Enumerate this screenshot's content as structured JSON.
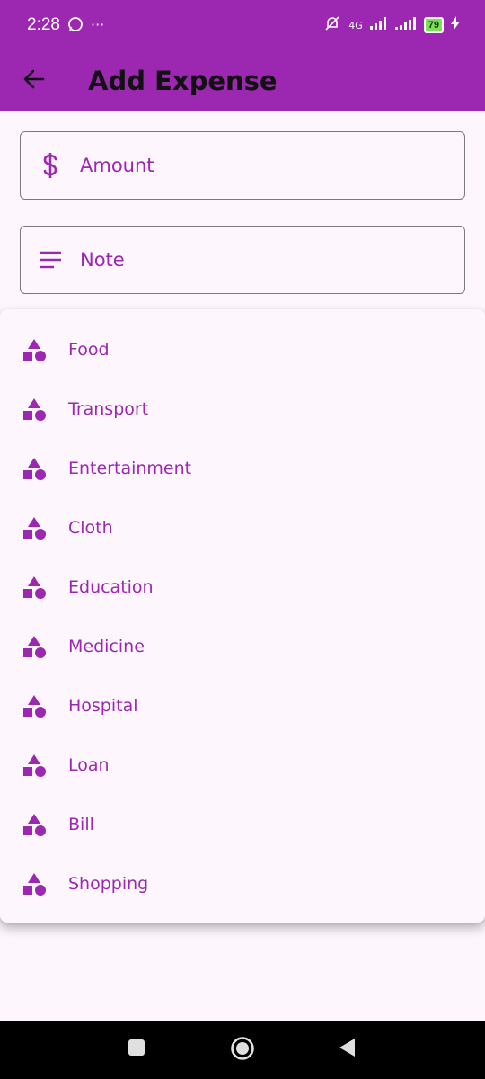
{
  "status_bar": {
    "time": "2:28",
    "whatsapp_icon": "whatsapp-icon",
    "more_dots": "···",
    "network": "4G",
    "battery": "79"
  },
  "app_bar": {
    "title": "Add Expense",
    "back_icon": "arrow-back-icon",
    "background": "#9c27b0"
  },
  "form": {
    "amount": {
      "label": "Amount",
      "icon": "dollar-icon"
    },
    "note": {
      "label": "Note",
      "icon": "notes-icon"
    }
  },
  "category_menu": {
    "item_icon": "category-icon",
    "items": [
      {
        "label": "Food"
      },
      {
        "label": "Transport"
      },
      {
        "label": "Entertainment"
      },
      {
        "label": "Cloth"
      },
      {
        "label": "Education"
      },
      {
        "label": "Medicine"
      },
      {
        "label": "Hospital"
      },
      {
        "label": "Loan"
      },
      {
        "label": "Bill"
      },
      {
        "label": "Shopping"
      }
    ]
  },
  "accent_color": "#9c27b0"
}
